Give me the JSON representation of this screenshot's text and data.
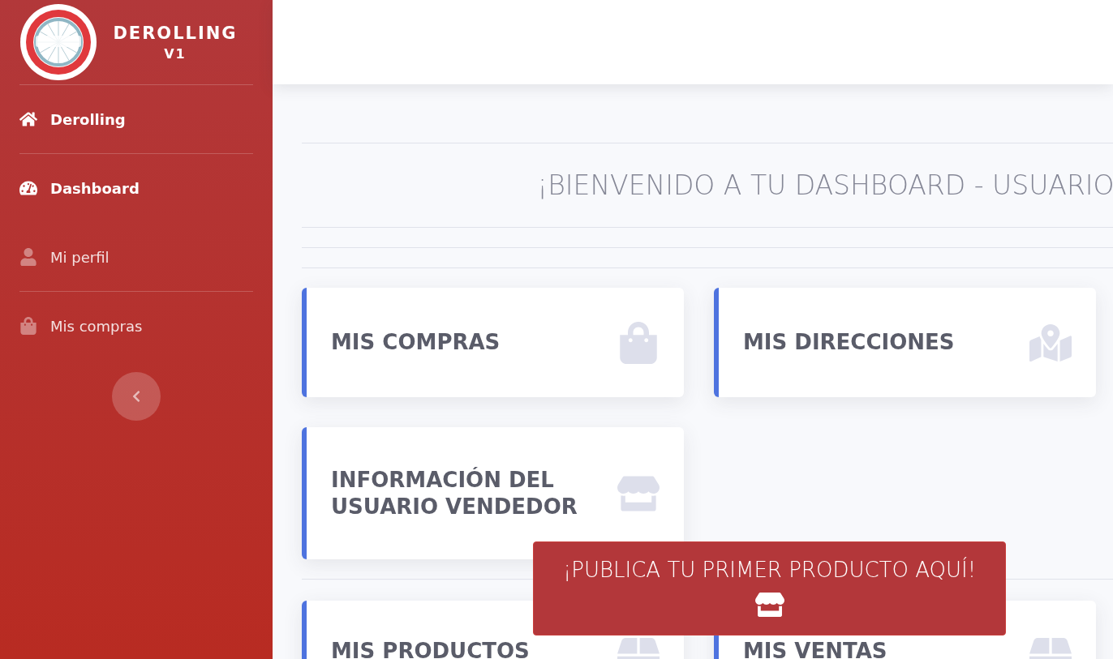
{
  "sidebar": {
    "brand": {
      "title": "DEROLLING",
      "version": "V1"
    },
    "items": [
      {
        "label": "Derolling",
        "emphasized": true,
        "divider_after": true
      },
      {
        "label": "Dashboard",
        "emphasized": true,
        "divider_after": false
      },
      {
        "label": "Mi perfil",
        "emphasized": false,
        "divider_after": true
      },
      {
        "label": "Mis compras",
        "emphasized": false,
        "divider_after": false
      }
    ]
  },
  "heading": "¡BIENVENIDO A TU DASHBOARD - USUARIO",
  "card_groups": [
    [
      {
        "title": "MIS COMPRAS"
      },
      {
        "title": "MIS DIRECCIONES"
      }
    ],
    [
      {
        "title": "INFORMACIÓN DEL USUARIO VENDEDOR"
      }
    ],
    [
      {
        "title": "MIS PRODUCTOS"
      },
      {
        "title": "MIS VENTAS"
      }
    ]
  ],
  "toast": {
    "text": "¡PUBLICA TU PRIMER PRODUCTO AQUÍ!"
  }
}
